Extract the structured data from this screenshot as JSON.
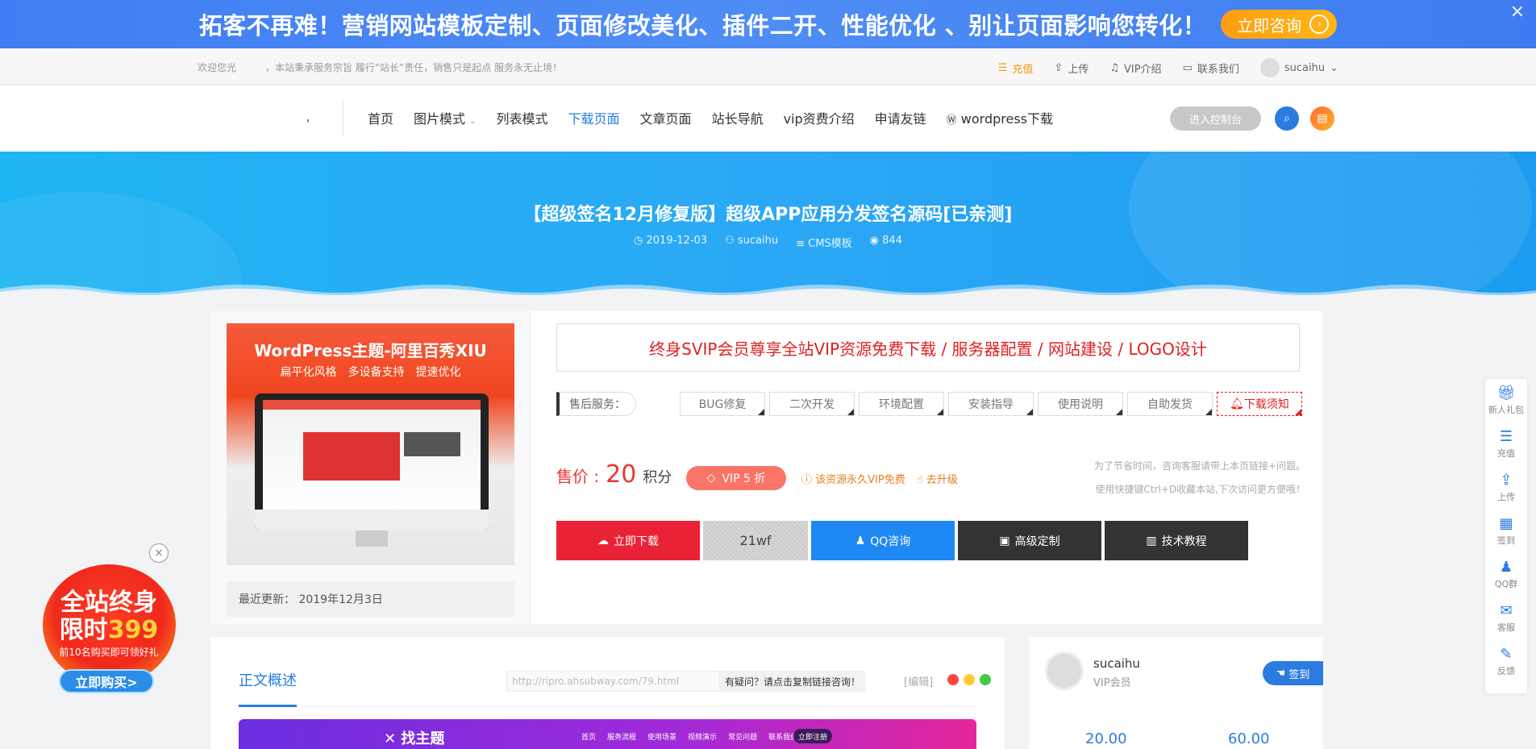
{
  "promo": {
    "text": "拓客不再难！营销网站模板定制、页面修改美化、插件二开、性能优化 、别让页面影响您转化！",
    "button": "立即咨询",
    "close": "×"
  },
  "topbar": {
    "welcome": "欢迎您光　　　，本站秉承服务宗旨 履行“站长”责任，销售只是起点 服务永无止境！",
    "items": [
      "充值",
      "上传",
      "VIP介绍",
      "联系我们"
    ],
    "username": "sucaihu"
  },
  "nav": {
    "logo_mark": ",",
    "menu": [
      "首页",
      "图片模式",
      "列表模式",
      "下载页面",
      "文章页面",
      "站长导航",
      "vip资费介绍",
      "申请友链",
      "wordpress下载"
    ],
    "console": "进入控制台"
  },
  "hero": {
    "title": "【超级签名12月修复版】超级APP应用分发签名源码[已亲测]",
    "date": "2019-12-03",
    "author": "sucaihu",
    "category": "CMS模板",
    "views": "844"
  },
  "product": {
    "thumb_title": "WordPress主题-阿里百秀XIU",
    "thumb_sub": "扁平化风格　多设备支持　提速优化",
    "update": "最近更新：  2019年12月3日",
    "slogan": "终身SVIP会员尊享全站VIP资源免费下载 / 服务器配置 / 网站建设 / LOGO设计",
    "service_label": "售后服务：",
    "service_tags": [
      "BUG修复",
      "二次开发",
      "环境配置",
      "安装指导",
      "使用说明",
      "自助发货"
    ],
    "notice": "下载须知",
    "price_label": "售价 :",
    "price": "20",
    "price_unit": "积分",
    "vip_badge": "VIP 5 折",
    "vip_free": "该资源永久VIP免费",
    "upgrade": "去升级",
    "tip1": "为了节省时间，咨询客服请带上本页链接+问题。",
    "tip2": "使用快捷键Ctrl+D收藏本站,下次访问更方便哦！",
    "btn_download": "立即下载",
    "code": "21wf",
    "btn_qq": "QQ咨询",
    "btn_custom": "高级定制",
    "btn_tutorial": "技术教程"
  },
  "article": {
    "tab": "正文概述",
    "url": "http://ripro.ahsubway.com/79.html",
    "ask": "有疑问？请点击复制链接咨询！",
    "edit": "[编辑]",
    "preview_logo": "找主题",
    "preview_menu": [
      "首页",
      "服务流程",
      "使用场景",
      "视频演示",
      "常见问题",
      "联系我们"
    ],
    "preview_btn": "立即注册"
  },
  "sidebar": {
    "name": "sucaihu",
    "role": "VIP会员",
    "signin": "签到",
    "stat1": "20.00",
    "stat2": "60.00"
  },
  "floatbar": [
    "新人礼包",
    "充值",
    "上传",
    "签到",
    "QQ群",
    "客服",
    "反馈"
  ],
  "badge": {
    "line1": "全站终身",
    "line2_a": "限时",
    "line2_b": "399",
    "line3": "前10名购买即可领好礼",
    "buy": "立即购买>"
  },
  "colors": {
    "accent": "#2b7be0",
    "promo_bg": "#4f8df5",
    "hero_bg": "#2ba8f5",
    "price_red": "#e33333",
    "download_red": "#ea2235"
  }
}
